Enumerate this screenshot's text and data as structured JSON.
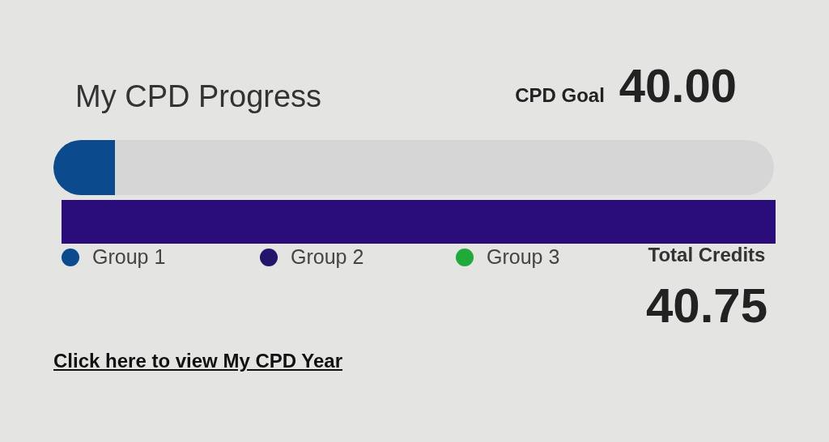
{
  "title": "My CPD Progress",
  "goal": {
    "label": "CPD Goal",
    "value": "40.00"
  },
  "bars": [
    {
      "kind": "rounded",
      "level": 0.085,
      "color": "#0b4a8c"
    },
    {
      "kind": "flat",
      "color": "#2a0c7a"
    }
  ],
  "legend": [
    {
      "label": "Group 1",
      "color": "#0b4a8c"
    },
    {
      "label": "Group 2",
      "color": "#24146b"
    },
    {
      "label": "Group 3",
      "color": "#1faa3a"
    }
  ],
  "total": {
    "label": "Total Credits",
    "value": "40.75"
  },
  "link": "Click here to view My CPD Year"
}
